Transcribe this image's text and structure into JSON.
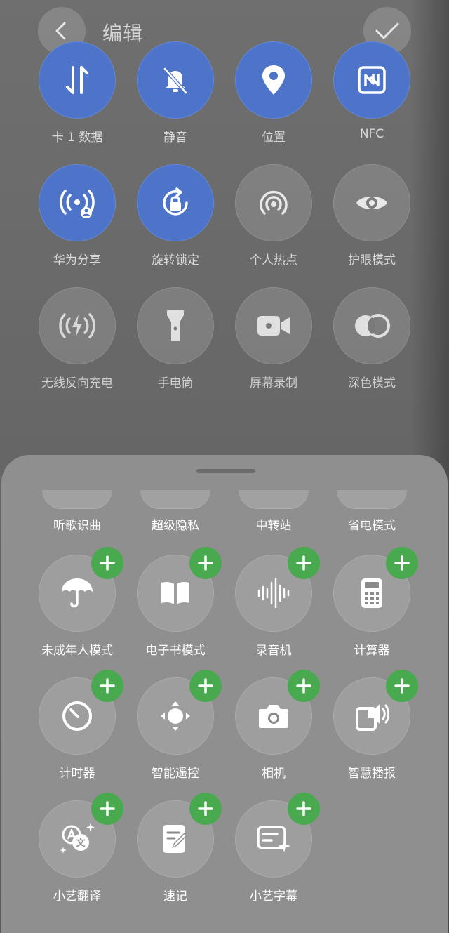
{
  "header": {
    "title": "编辑",
    "back_icon": "chevron-left-icon",
    "confirm_icon": "checkmark-icon"
  },
  "tiles": [
    {
      "label": "卡 1 数据",
      "icon": "mobile-data-icon",
      "active": true
    },
    {
      "label": "静音",
      "icon": "bell-off-icon",
      "active": true
    },
    {
      "label": "位置",
      "icon": "location-pin-icon",
      "active": true
    },
    {
      "label": "NFC",
      "icon": "nfc-icon",
      "active": true
    },
    {
      "label": "华为分享",
      "icon": "huawei-share-icon",
      "active": true
    },
    {
      "label": "旋转锁定",
      "icon": "rotation-lock-icon",
      "active": true
    },
    {
      "label": "个人热点",
      "icon": "hotspot-icon",
      "active": false
    },
    {
      "label": "护眼模式",
      "icon": "eye-icon",
      "active": false
    },
    {
      "label": "无线反向充电",
      "icon": "wireless-reverse-charge-icon",
      "active": false
    },
    {
      "label": "手电筒",
      "icon": "flashlight-icon",
      "active": false
    },
    {
      "label": "屏幕录制",
      "icon": "screen-record-icon",
      "active": false
    },
    {
      "label": "深色模式",
      "icon": "dark-mode-icon",
      "active": false
    }
  ],
  "sheet": {
    "partial_items": [
      {
        "label": "听歌识曲"
      },
      {
        "label": "超级隐私"
      },
      {
        "label": "中转站"
      },
      {
        "label": "省电模式"
      }
    ],
    "items": [
      {
        "label": "未成年人模式",
        "icon": "umbrella-icon"
      },
      {
        "label": "电子书模式",
        "icon": "book-icon"
      },
      {
        "label": "录音机",
        "icon": "sound-wave-icon"
      },
      {
        "label": "计算器",
        "icon": "calculator-icon"
      },
      {
        "label": "计时器",
        "icon": "timer-icon"
      },
      {
        "label": "智能遥控",
        "icon": "remote-control-icon"
      },
      {
        "label": "相机",
        "icon": "camera-icon"
      },
      {
        "label": "智慧播报",
        "icon": "speaker-broadcast-icon"
      },
      {
        "label": "小艺翻译",
        "icon": "translate-icon"
      },
      {
        "label": "速记",
        "icon": "note-edit-icon"
      },
      {
        "label": "小艺字幕",
        "icon": "subtitles-icon"
      }
    ],
    "add_icon": "plus-icon"
  },
  "colors": {
    "active": "#4d74c9",
    "add": "#48a94f",
    "sheet": "#8f8f8f"
  }
}
